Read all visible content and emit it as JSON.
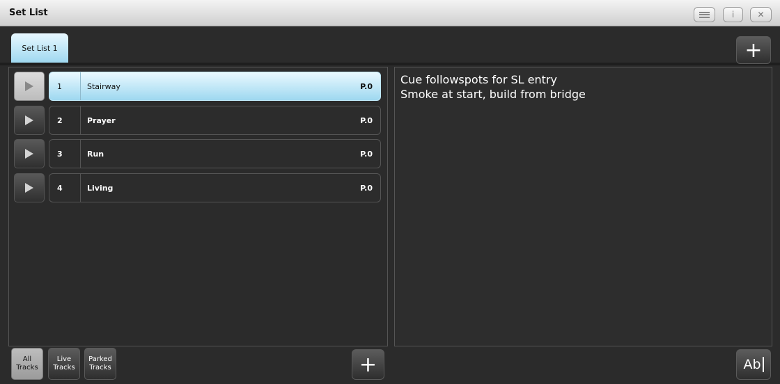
{
  "window": {
    "title": "Set List"
  },
  "titlebar_buttons": {
    "info": "i",
    "close": "✕"
  },
  "tabs": [
    {
      "label": "Set List 1"
    }
  ],
  "tracks": [
    {
      "number": "1",
      "name": "Stairway",
      "page": "P.0"
    },
    {
      "number": "2",
      "name": "Prayer",
      "page": "P.0"
    },
    {
      "number": "3",
      "name": "Run",
      "page": "P.0"
    },
    {
      "number": "4",
      "name": "Living",
      "page": "P.0"
    }
  ],
  "notes": {
    "line1": "Cue followspots for SL entry",
    "line2": "Smoke at start, build from bridge"
  },
  "filters": [
    {
      "label": "All\nTracks"
    },
    {
      "label": "Live\nTracks"
    },
    {
      "label": "Parked\nTracks"
    }
  ],
  "buttons": {
    "add": "+",
    "edit_text": "Ab"
  },
  "colors": {
    "selected": "#9ed8f0",
    "background": "#2b2b2b"
  },
  "icons": {
    "play": "play-icon",
    "menu": "menu-icon",
    "close": "close-icon",
    "info": "info-icon",
    "plus": "plus-icon",
    "text_edit": "text-edit-icon"
  }
}
